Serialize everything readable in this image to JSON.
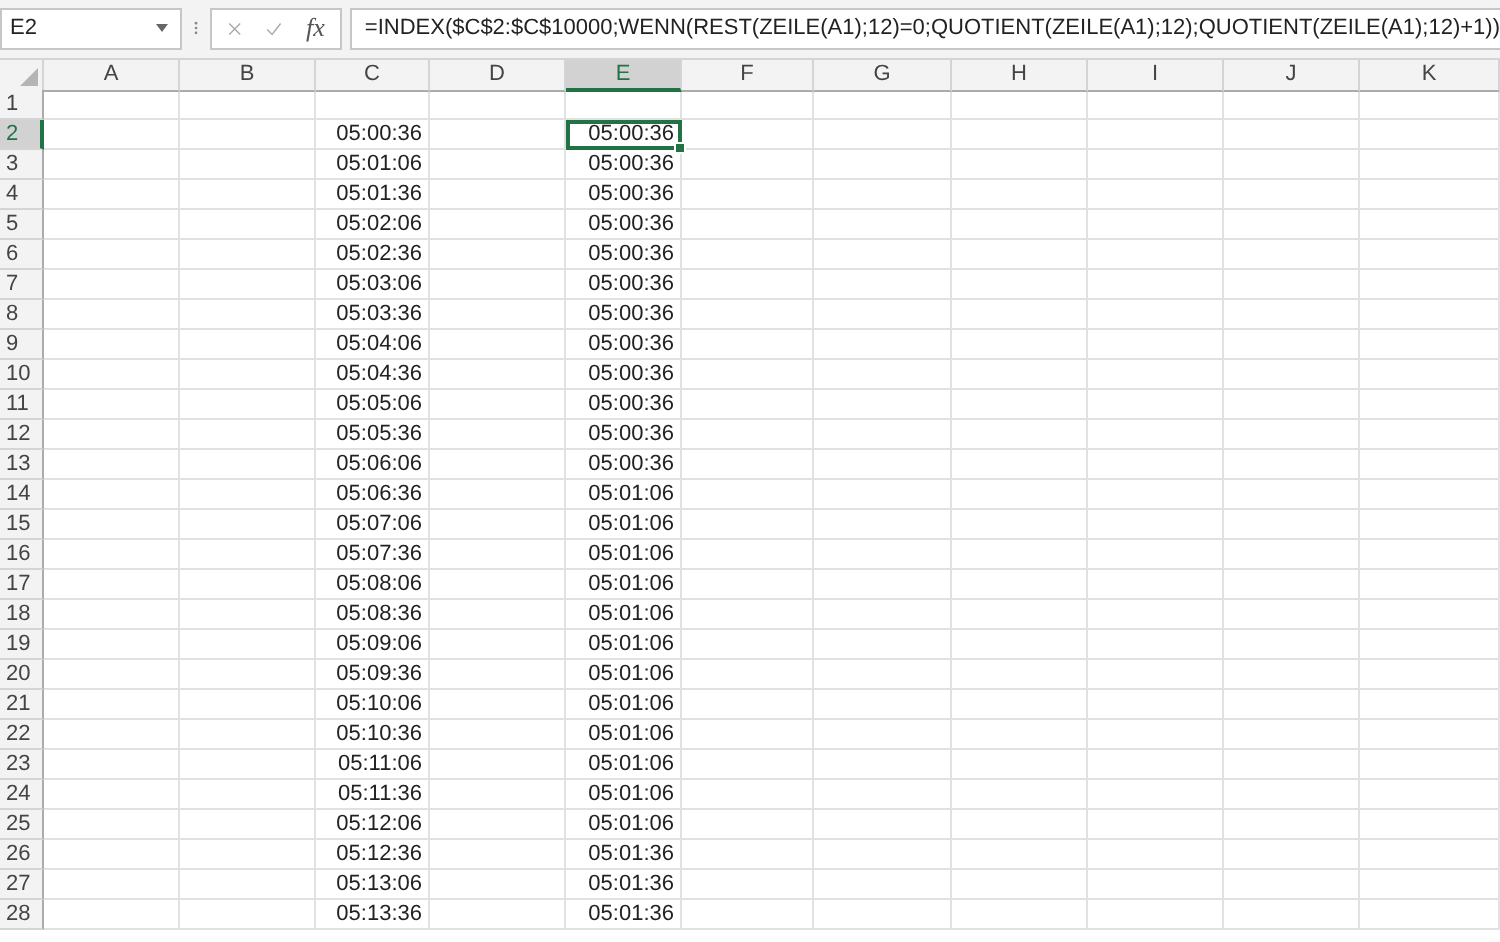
{
  "formula_bar": {
    "name_box": "E2",
    "function_label": "fx",
    "formula": "=INDEX($C$2:$C$10000;WENN(REST(ZEILE(A1);12)=0;QUOTIENT(ZEILE(A1);12);QUOTIENT(ZEILE(A1);12)+1))"
  },
  "columns": [
    {
      "label": "A",
      "selected": false
    },
    {
      "label": "B",
      "selected": false
    },
    {
      "label": "C",
      "selected": false
    },
    {
      "label": "D",
      "selected": false
    },
    {
      "label": "E",
      "selected": true
    },
    {
      "label": "F",
      "selected": false
    },
    {
      "label": "G",
      "selected": false
    },
    {
      "label": "H",
      "selected": false
    },
    {
      "label": "I",
      "selected": false
    },
    {
      "label": "J",
      "selected": false
    },
    {
      "label": "K",
      "selected": false
    }
  ],
  "rows": [
    {
      "label": "1",
      "selected": false
    },
    {
      "label": "2",
      "selected": true,
      "column_c": {
        "value": "05:00:36",
        "selected": false
      },
      "column_e": {
        "value": "05:00:36",
        "selected": true
      }
    },
    {
      "label": "3",
      "selected": false,
      "column_c": {
        "value": "05:01:06",
        "selected": false
      },
      "column_e": {
        "value": "05:00:36",
        "selected": false
      }
    },
    {
      "label": "4",
      "selected": false,
      "column_c": {
        "value": "05:01:36",
        "selected": false
      },
      "column_e": {
        "value": "05:00:36",
        "selected": false
      }
    },
    {
      "label": "5",
      "selected": false,
      "column_c": {
        "value": "05:02:06",
        "selected": false
      },
      "column_e": {
        "value": "05:00:36",
        "selected": false
      }
    },
    {
      "label": "6",
      "selected": false,
      "column_c": {
        "value": "05:02:36",
        "selected": false
      },
      "column_e": {
        "value": "05:00:36",
        "selected": false
      }
    },
    {
      "label": "7",
      "selected": false,
      "column_c": {
        "value": "05:03:06",
        "selected": false
      },
      "column_e": {
        "value": "05:00:36",
        "selected": false
      }
    },
    {
      "label": "8",
      "selected": false,
      "column_c": {
        "value": "05:03:36",
        "selected": false
      },
      "column_e": {
        "value": "05:00:36",
        "selected": false
      }
    },
    {
      "label": "9",
      "selected": false,
      "column_c": {
        "value": "05:04:06",
        "selected": false
      },
      "column_e": {
        "value": "05:00:36",
        "selected": false
      }
    },
    {
      "label": "10",
      "selected": false,
      "column_c": {
        "value": "05:04:36",
        "selected": false
      },
      "column_e": {
        "value": "05:00:36",
        "selected": false
      }
    },
    {
      "label": "11",
      "selected": false,
      "column_c": {
        "value": "05:05:06",
        "selected": false
      },
      "column_e": {
        "value": "05:00:36",
        "selected": false
      }
    },
    {
      "label": "12",
      "selected": false,
      "column_c": {
        "value": "05:05:36",
        "selected": false
      },
      "column_e": {
        "value": "05:00:36",
        "selected": false
      }
    },
    {
      "label": "13",
      "selected": false,
      "column_c": {
        "value": "05:06:06",
        "selected": false
      },
      "column_e": {
        "value": "05:00:36",
        "selected": false
      }
    },
    {
      "label": "14",
      "selected": false,
      "column_c": {
        "value": "05:06:36",
        "selected": false
      },
      "column_e": {
        "value": "05:01:06",
        "selected": false
      }
    },
    {
      "label": "15",
      "selected": false,
      "column_c": {
        "value": "05:07:06",
        "selected": false
      },
      "column_e": {
        "value": "05:01:06",
        "selected": false
      }
    },
    {
      "label": "16",
      "selected": false,
      "column_c": {
        "value": "05:07:36",
        "selected": false
      },
      "column_e": {
        "value": "05:01:06",
        "selected": false
      }
    },
    {
      "label": "17",
      "selected": false,
      "column_c": {
        "value": "05:08:06",
        "selected": false
      },
      "column_e": {
        "value": "05:01:06",
        "selected": false
      }
    },
    {
      "label": "18",
      "selected": false,
      "column_c": {
        "value": "05:08:36",
        "selected": false
      },
      "column_e": {
        "value": "05:01:06",
        "selected": false
      }
    },
    {
      "label": "19",
      "selected": false,
      "column_c": {
        "value": "05:09:06",
        "selected": false
      },
      "column_e": {
        "value": "05:01:06",
        "selected": false
      }
    },
    {
      "label": "20",
      "selected": false,
      "column_c": {
        "value": "05:09:36",
        "selected": false
      },
      "column_e": {
        "value": "05:01:06",
        "selected": false
      }
    },
    {
      "label": "21",
      "selected": false,
      "column_c": {
        "value": "05:10:06",
        "selected": false
      },
      "column_e": {
        "value": "05:01:06",
        "selected": false
      }
    },
    {
      "label": "22",
      "selected": false,
      "column_c": {
        "value": "05:10:36",
        "selected": false
      },
      "column_e": {
        "value": "05:01:06",
        "selected": false
      }
    },
    {
      "label": "23",
      "selected": false,
      "column_c": {
        "value": "05:11:06",
        "selected": false
      },
      "column_e": {
        "value": "05:01:06",
        "selected": false
      }
    },
    {
      "label": "24",
      "selected": false,
      "column_c": {
        "value": "05:11:36",
        "selected": false
      },
      "column_e": {
        "value": "05:01:06",
        "selected": false
      }
    },
    {
      "label": "25",
      "selected": false,
      "column_c": {
        "value": "05:12:06",
        "selected": false
      },
      "column_e": {
        "value": "05:01:06",
        "selected": false
      }
    },
    {
      "label": "26",
      "selected": false,
      "column_c": {
        "value": "05:12:36",
        "selected": false
      },
      "column_e": {
        "value": "05:01:36",
        "selected": false
      }
    },
    {
      "label": "27",
      "selected": false,
      "column_c": {
        "value": "05:13:06",
        "selected": false
      },
      "column_e": {
        "value": "05:01:36",
        "selected": false
      }
    },
    {
      "label": "28",
      "selected": false,
      "column_c": {
        "value": "05:13:36",
        "selected": false
      },
      "column_e": {
        "value": "05:01:36",
        "selected": false
      }
    }
  ]
}
